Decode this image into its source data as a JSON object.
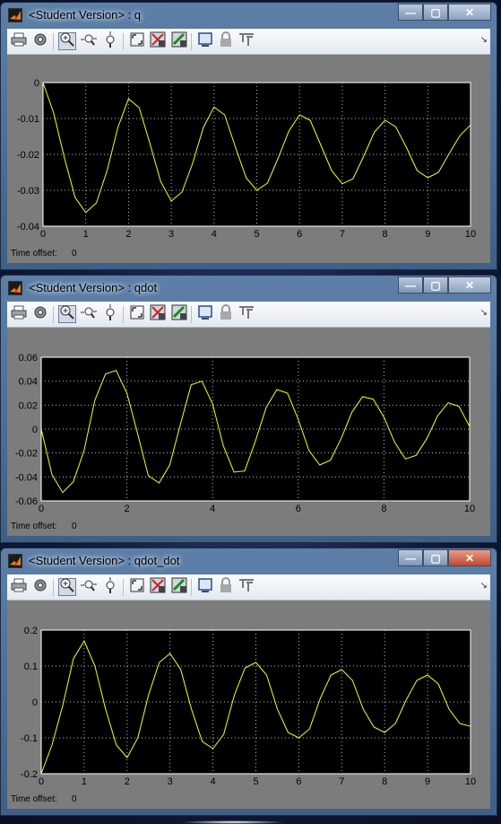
{
  "windows": [
    {
      "title": "<Student Version> : q",
      "time_offset_label": "Time offset:",
      "time_offset_value": "0",
      "active": false,
      "plot": {
        "y_ticks": [
          "0",
          "-0.01",
          "-0.02",
          "-0.03",
          "-0.04"
        ],
        "x_ticks": [
          "0",
          "1",
          "2",
          "3",
          "4",
          "5",
          "6",
          "7",
          "8",
          "9",
          "10"
        ]
      }
    },
    {
      "title": "<Student Version> : qdot",
      "time_offset_label": "Time offset:",
      "time_offset_value": "0",
      "active": false,
      "plot": {
        "y_ticks": [
          "0.06",
          "0.04",
          "0.02",
          "0",
          "-0.02",
          "-0.04",
          "-0.06"
        ],
        "x_ticks": [
          "0",
          "2",
          "4",
          "6",
          "8",
          "10"
        ]
      }
    },
    {
      "title": "<Student Version> : qdot_dot",
      "time_offset_label": "Time offset:",
      "time_offset_value": "0",
      "active": true,
      "plot": {
        "y_ticks": [
          "0.2",
          "0.1",
          "0",
          "-0.1",
          "-0.2"
        ],
        "x_ticks": [
          "0",
          "1",
          "2",
          "3",
          "4",
          "5",
          "6",
          "7",
          "8",
          "9",
          "10"
        ]
      }
    }
  ],
  "toolbar_icons": [
    "print-icon",
    "parameters-icon",
    "zoom-icon",
    "zoom-x-icon",
    "zoom-y-icon",
    "autoscale-icon",
    "save-axes-icon",
    "restore-axes-icon",
    "floating-scope-icon",
    "lock-icon",
    "signal-selection-icon"
  ],
  "chart_data": [
    {
      "type": "line",
      "title": "",
      "xlim": [
        0,
        10
      ],
      "ylim": [
        -0.04,
        0
      ],
      "grid": true,
      "series": [
        {
          "color": "#ffff00",
          "x": [
            0,
            0.25,
            0.5,
            0.75,
            1,
            1.25,
            1.5,
            1.75,
            2,
            2.25,
            2.5,
            2.75,
            3,
            3.25,
            3.5,
            3.75,
            4,
            4.25,
            4.5,
            4.75,
            5,
            5.25,
            5.5,
            5.75,
            6,
            6.25,
            6.5,
            6.75,
            7,
            7.25,
            7.5,
            7.75,
            8,
            8.25,
            8.5,
            8.75,
            9,
            9.25,
            9.5,
            9.75,
            10
          ],
          "y": [
            0,
            -0.0085,
            -0.021,
            -0.032,
            -0.0362,
            -0.0335,
            -0.0245,
            -0.0125,
            -0.0045,
            -0.007,
            -0.017,
            -0.0275,
            -0.033,
            -0.0305,
            -0.0225,
            -0.0125,
            -0.0068,
            -0.009,
            -0.018,
            -0.0265,
            -0.03,
            -0.028,
            -0.021,
            -0.0135,
            -0.009,
            -0.0105,
            -0.0175,
            -0.0245,
            -0.0282,
            -0.0268,
            -0.0205,
            -0.0138,
            -0.0105,
            -0.0123,
            -0.018,
            -0.0245,
            -0.0265,
            -0.025,
            -0.0198,
            -0.0148,
            -0.0118
          ]
        }
      ]
    },
    {
      "type": "line",
      "title": "",
      "xlim": [
        0,
        10
      ],
      "ylim": [
        -0.06,
        0.06
      ],
      "grid": true,
      "series": [
        {
          "color": "#ffff00",
          "x": [
            0,
            0.25,
            0.5,
            0.75,
            1,
            1.25,
            1.5,
            1.75,
            2,
            2.25,
            2.5,
            2.75,
            3,
            3.25,
            3.5,
            3.75,
            4,
            4.25,
            4.5,
            4.75,
            5,
            5.25,
            5.5,
            5.75,
            6,
            6.25,
            6.5,
            6.75,
            7,
            7.25,
            7.5,
            7.75,
            8,
            8.25,
            8.5,
            8.75,
            9,
            9.25,
            9.5,
            9.75,
            10
          ],
          "y": [
            0,
            -0.038,
            -0.053,
            -0.044,
            -0.018,
            0.024,
            0.046,
            0.049,
            0.03,
            -0.004,
            -0.039,
            -0.045,
            -0.03,
            0.004,
            0.037,
            0.04,
            0.021,
            -0.014,
            -0.036,
            -0.035,
            -0.01,
            0.018,
            0.033,
            0.03,
            0.008,
            -0.018,
            -0.03,
            -0.026,
            -0.008,
            0.014,
            0.027,
            0.025,
            0.01,
            -0.011,
            -0.025,
            -0.022,
            -0.008,
            0.011,
            0.022,
            0.019,
            0.002
          ]
        }
      ]
    },
    {
      "type": "line",
      "title": "",
      "xlim": [
        0,
        10
      ],
      "ylim": [
        -0.2,
        0.2
      ],
      "grid": true,
      "series": [
        {
          "color": "#ffff00",
          "x": [
            0,
            0.25,
            0.5,
            0.75,
            1,
            1.25,
            1.5,
            1.75,
            2,
            2.25,
            2.5,
            2.75,
            3,
            3.25,
            3.5,
            3.75,
            4,
            4.25,
            4.5,
            4.75,
            5,
            5.25,
            5.5,
            5.75,
            6,
            6.25,
            6.5,
            6.75,
            7,
            7.25,
            7.5,
            7.75,
            8,
            8.25,
            8.5,
            8.75,
            9,
            9.25,
            9.5,
            9.75,
            10
          ],
          "y": [
            -0.2,
            -0.12,
            -0.01,
            0.12,
            0.17,
            0.1,
            -0.02,
            -0.12,
            -0.155,
            -0.1,
            0.02,
            0.11,
            0.135,
            0.09,
            -0.02,
            -0.11,
            -0.13,
            -0.09,
            0.02,
            0.095,
            0.11,
            0.075,
            -0.02,
            -0.085,
            -0.1,
            -0.075,
            0.01,
            0.075,
            0.09,
            0.06,
            -0.02,
            -0.07,
            -0.085,
            -0.06,
            0.005,
            0.06,
            0.075,
            0.05,
            -0.02,
            -0.06,
            -0.068
          ]
        }
      ]
    }
  ]
}
